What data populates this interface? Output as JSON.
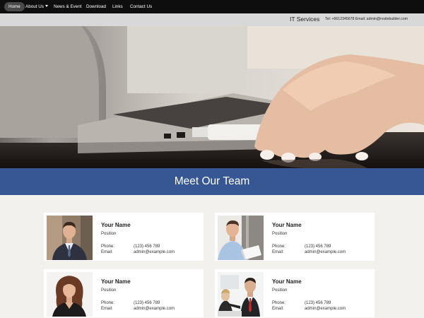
{
  "nav": {
    "items": [
      {
        "label": "Home",
        "active": true
      },
      {
        "label": "About Us",
        "dropdown": true
      },
      {
        "label": "News & Event"
      },
      {
        "label": "Download"
      },
      {
        "label": "Links"
      },
      {
        "label": "Contact Us"
      }
    ]
  },
  "infobar": {
    "brand": "IT Services",
    "contact": "Tel: +6612345678  Email: admin@rvsitebuilder.com"
  },
  "hero": {
    "image": "laptop-hand-usb-photo"
  },
  "team": {
    "title": "Meet Our Team",
    "members": [
      {
        "name": "Your Name",
        "position": "Position",
        "phone_label": "Phone:",
        "phone": "(123) 456 789",
        "email_label": "Email:",
        "email": "admin@example.com",
        "photo": "man-in-suit-photo"
      },
      {
        "name": "Your Name",
        "position": "Position",
        "phone_label": "Phone:",
        "phone": "(123) 456 789",
        "email_label": "Email:",
        "email": "admin@example.com",
        "photo": "smiling-man-with-papers-photo"
      },
      {
        "name": "Your Name",
        "position": "Position",
        "phone_label": "Phone:",
        "phone": "(123) 456 789",
        "email_label": "Email:",
        "email": "admin@example.com",
        "photo": "woman-with-curly-hair-photo"
      },
      {
        "name": "Your Name",
        "position": "Position",
        "phone_label": "Phone:",
        "phone": "(123) 456 789",
        "email_label": "Email:",
        "email": "admin@example.com",
        "photo": "office-meeting-photo"
      }
    ]
  },
  "colors": {
    "nav_bg": "#0e0e0e",
    "infobar_bg": "#d8d8d8",
    "banner_bg": "#375694",
    "page_bg": "#f3f1ee"
  }
}
